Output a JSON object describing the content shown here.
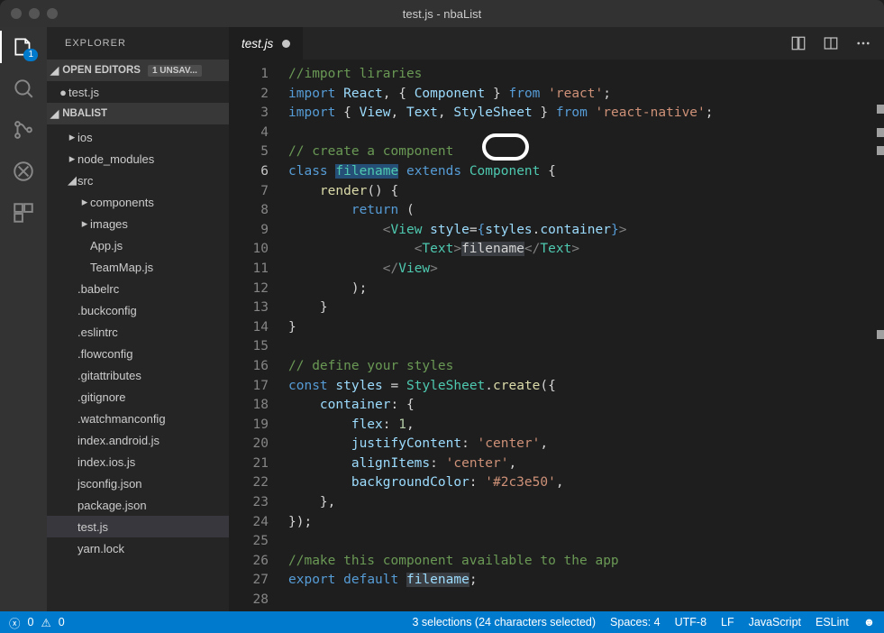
{
  "title": "test.js - nbaList",
  "activity": {
    "badge": "1"
  },
  "sidebar": {
    "title": "EXPLORER",
    "sections": {
      "openEditors": {
        "label": "OPEN EDITORS",
        "badge": "1 UNSAV..."
      },
      "project": {
        "label": "NBALIST"
      }
    },
    "openEditorItems": [
      {
        "label": "test.js",
        "dirty": true
      }
    ],
    "tree": [
      {
        "label": "ios",
        "depth": 0,
        "type": "folder",
        "expanded": false
      },
      {
        "label": "node_modules",
        "depth": 0,
        "type": "folder",
        "expanded": false
      },
      {
        "label": "src",
        "depth": 0,
        "type": "folder",
        "expanded": true
      },
      {
        "label": "components",
        "depth": 1,
        "type": "folder",
        "expanded": false
      },
      {
        "label": "images",
        "depth": 1,
        "type": "folder",
        "expanded": false
      },
      {
        "label": "App.js",
        "depth": 1,
        "type": "file"
      },
      {
        "label": "TeamMap.js",
        "depth": 1,
        "type": "file"
      },
      {
        "label": ".babelrc",
        "depth": 0,
        "type": "file"
      },
      {
        "label": ".buckconfig",
        "depth": 0,
        "type": "file"
      },
      {
        "label": ".eslintrc",
        "depth": 0,
        "type": "file"
      },
      {
        "label": ".flowconfig",
        "depth": 0,
        "type": "file"
      },
      {
        "label": ".gitattributes",
        "depth": 0,
        "type": "file"
      },
      {
        "label": ".gitignore",
        "depth": 0,
        "type": "file"
      },
      {
        "label": ".watchmanconfig",
        "depth": 0,
        "type": "file"
      },
      {
        "label": "index.android.js",
        "depth": 0,
        "type": "file"
      },
      {
        "label": "index.ios.js",
        "depth": 0,
        "type": "file"
      },
      {
        "label": "jsconfig.json",
        "depth": 0,
        "type": "file"
      },
      {
        "label": "package.json",
        "depth": 0,
        "type": "file"
      },
      {
        "label": "test.js",
        "depth": 0,
        "type": "file",
        "selected": true
      },
      {
        "label": "yarn.lock",
        "depth": 0,
        "type": "file"
      }
    ]
  },
  "tab": {
    "name": "test.js"
  },
  "code": {
    "lines": [
      {
        "n": 1,
        "html": "<span class='c-cm'>//import liraries</span>"
      },
      {
        "n": 2,
        "html": "<span class='c-kw'>import</span> <span class='c-id'>React</span><span class='c-pu'>, { </span><span class='c-id'>Component</span><span class='c-pu'> } </span><span class='c-kw'>from</span> <span class='c-st'>'react'</span><span class='c-pu'>;</span>"
      },
      {
        "n": 3,
        "html": "<span class='c-kw'>import</span> <span class='c-pu'>{ </span><span class='c-id'>View</span><span class='c-pu'>, </span><span class='c-id'>Text</span><span class='c-pu'>, </span><span class='c-id'>StyleSheet</span><span class='c-pu'> } </span><span class='c-kw'>from</span> <span class='c-st'>'react-native'</span><span class='c-pu'>;</span>"
      },
      {
        "n": 4,
        "html": ""
      },
      {
        "n": 5,
        "html": "<span class='c-cm'>// create a component</span>"
      },
      {
        "n": 6,
        "html": "<span class='c-kw'>class</span> <span class='c-ty sel'>filename</span> <span class='c-kw'>extends</span> <span class='c-ty'>Component</span> <span class='c-pu'>{</span>",
        "active": true
      },
      {
        "n": 7,
        "html": "    <span class='c-fn'>render</span><span class='c-pu'>() {</span>"
      },
      {
        "n": 8,
        "html": "        <span class='c-kw'>return</span> <span class='c-pu'>(</span>"
      },
      {
        "n": 9,
        "html": "            <span class='c-br'>&lt;</span><span class='c-tag'>View</span> <span class='c-id'>style</span><span class='c-pu'>=</span><span class='c-kw'>{</span><span class='c-id'>styles</span><span class='c-pu'>.</span><span class='c-id'>container</span><span class='c-kw'>}</span><span class='c-br'>&gt;</span>"
      },
      {
        "n": 10,
        "html": "                <span class='c-br'>&lt;</span><span class='c-tag'>Text</span><span class='c-br'>&gt;</span><span class='sel-alt'>filename</span><span class='c-br'>&lt;/</span><span class='c-tag'>Text</span><span class='c-br'>&gt;</span>"
      },
      {
        "n": 11,
        "html": "            <span class='c-br'>&lt;/</span><span class='c-tag'>View</span><span class='c-br'>&gt;</span>"
      },
      {
        "n": 12,
        "html": "        <span class='c-pu'>);</span>"
      },
      {
        "n": 13,
        "html": "    <span class='c-pu'>}</span>"
      },
      {
        "n": 14,
        "html": "<span class='c-pu'>}</span>"
      },
      {
        "n": 15,
        "html": ""
      },
      {
        "n": 16,
        "html": "<span class='c-cm'>// define your styles</span>"
      },
      {
        "n": 17,
        "html": "<span class='c-kw'>const</span> <span class='c-id'>styles</span> <span class='c-pu'>=</span> <span class='c-ty'>StyleSheet</span><span class='c-pu'>.</span><span class='c-fn'>create</span><span class='c-pu'>({</span>"
      },
      {
        "n": 18,
        "html": "    <span class='c-id'>container</span><span class='c-pu'>: {</span>"
      },
      {
        "n": 19,
        "html": "        <span class='c-id'>flex</span><span class='c-pu'>: </span><span class='c-nm'>1</span><span class='c-pu'>,</span>"
      },
      {
        "n": 20,
        "html": "        <span class='c-id'>justifyContent</span><span class='c-pu'>: </span><span class='c-st'>'center'</span><span class='c-pu'>,</span>"
      },
      {
        "n": 21,
        "html": "        <span class='c-id'>alignItems</span><span class='c-pu'>: </span><span class='c-st'>'center'</span><span class='c-pu'>,</span>"
      },
      {
        "n": 22,
        "html": "        <span class='c-id'>backgroundColor</span><span class='c-pu'>: </span><span class='c-st'>'#2c3e50'</span><span class='c-pu'>,</span>"
      },
      {
        "n": 23,
        "html": "    <span class='c-pu'>},</span>"
      },
      {
        "n": 24,
        "html": "<span class='c-pu'>});</span>"
      },
      {
        "n": 25,
        "html": ""
      },
      {
        "n": 26,
        "html": "<span class='c-cm'>//make this component available to the app</span>"
      },
      {
        "n": 27,
        "html": "<span class='c-kw'>export</span> <span class='c-kw'>default</span> <span class='c-id sel-alt'>filename</span><span class='c-pu'>;</span>"
      },
      {
        "n": 28,
        "html": ""
      }
    ]
  },
  "status": {
    "errors": "0",
    "warnings": "0",
    "selection": "3 selections (24 characters selected)",
    "spaces": "Spaces: 4",
    "encoding": "UTF-8",
    "eol": "LF",
    "lang": "JavaScript",
    "linter": "ESLint"
  }
}
